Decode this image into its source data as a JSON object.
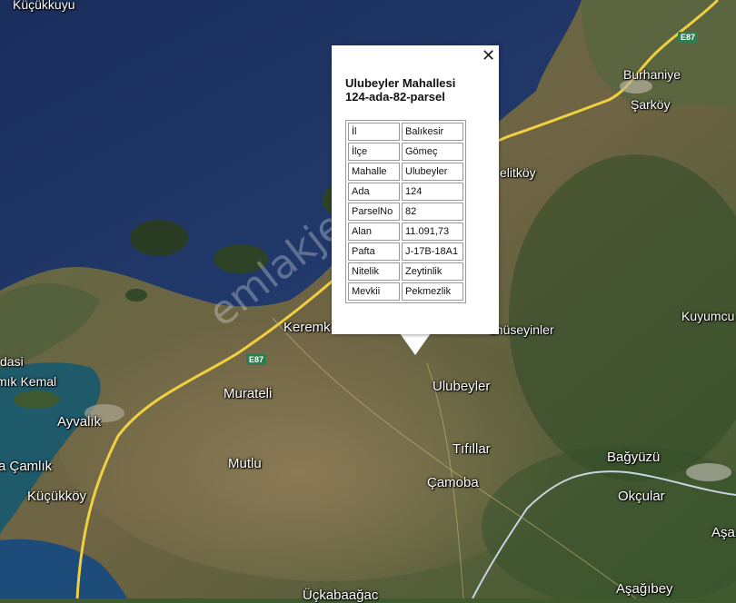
{
  "map": {
    "colors": {
      "sea": "#1e3566",
      "sea_deep": "#15284f",
      "land": "#4a5f34",
      "land_dry": "#7a6b4a",
      "road_highway": "#f0d040",
      "road_boundary": "#c8d4e0"
    },
    "watermark": "emlakjet.com",
    "places": [
      {
        "id": "kucukkuyu",
        "name": "Küçükkuyu"
      },
      {
        "id": "burhaniye",
        "name": "Burhaniye"
      },
      {
        "id": "sarkoy",
        "name": "Şarköy"
      },
      {
        "id": "delitkoy",
        "name": "elitköy"
      },
      {
        "id": "kuyumcu",
        "name": "Kuyumcu"
      },
      {
        "id": "kerem",
        "name": "Keremk"
      },
      {
        "id": "huseyinler",
        "name": "ühüseyinler"
      },
      {
        "id": "dasi",
        "name": "dasi"
      },
      {
        "id": "kemal",
        "name": "mık Kemal"
      },
      {
        "id": "murateli",
        "name": "Murateli"
      },
      {
        "id": "ulubeyler",
        "name": "Ulubeyler"
      },
      {
        "id": "ayvalik",
        "name": "Ayvalık"
      },
      {
        "id": "tifillar",
        "name": "Tıfıllar"
      },
      {
        "id": "bagyuzu",
        "name": "Bağyüzü"
      },
      {
        "id": "camlik",
        "name": "a Çamlık"
      },
      {
        "id": "mutlu",
        "name": "Mutlu"
      },
      {
        "id": "camoba",
        "name": "Çamoba"
      },
      {
        "id": "okcular",
        "name": "Okçular"
      },
      {
        "id": "kucukkoy",
        "name": "Küçükköy"
      },
      {
        "id": "asa",
        "name": "Aşa"
      },
      {
        "id": "asagibey",
        "name": "Aşağıbey"
      },
      {
        "id": "uckabaagac",
        "name": "Üçkabaağac"
      }
    ],
    "road_shields": [
      {
        "id": "e87_north",
        "label": "E87"
      },
      {
        "id": "e87_south",
        "label": "E87"
      }
    ]
  },
  "popup": {
    "close_symbol": "✕",
    "title_line1": "Ulubeyler Mahallesi",
    "title_line2": "124-ada-82-parsel",
    "rows": [
      {
        "key": "İl",
        "value": "Balıkesir"
      },
      {
        "key": "İlçe",
        "value": "Gömeç"
      },
      {
        "key": "Mahalle",
        "value": "Ulubeyler"
      },
      {
        "key": "Ada",
        "value": "124"
      },
      {
        "key": "ParselNo",
        "value": "82"
      },
      {
        "key": "Alan",
        "value": "11.091,73"
      },
      {
        "key": "Pafta",
        "value": "J-17B-18A1"
      },
      {
        "key": "Nitelik",
        "value": "Zeytinlik"
      },
      {
        "key": "Mevkii",
        "value": "Pekmezlik"
      }
    ]
  }
}
